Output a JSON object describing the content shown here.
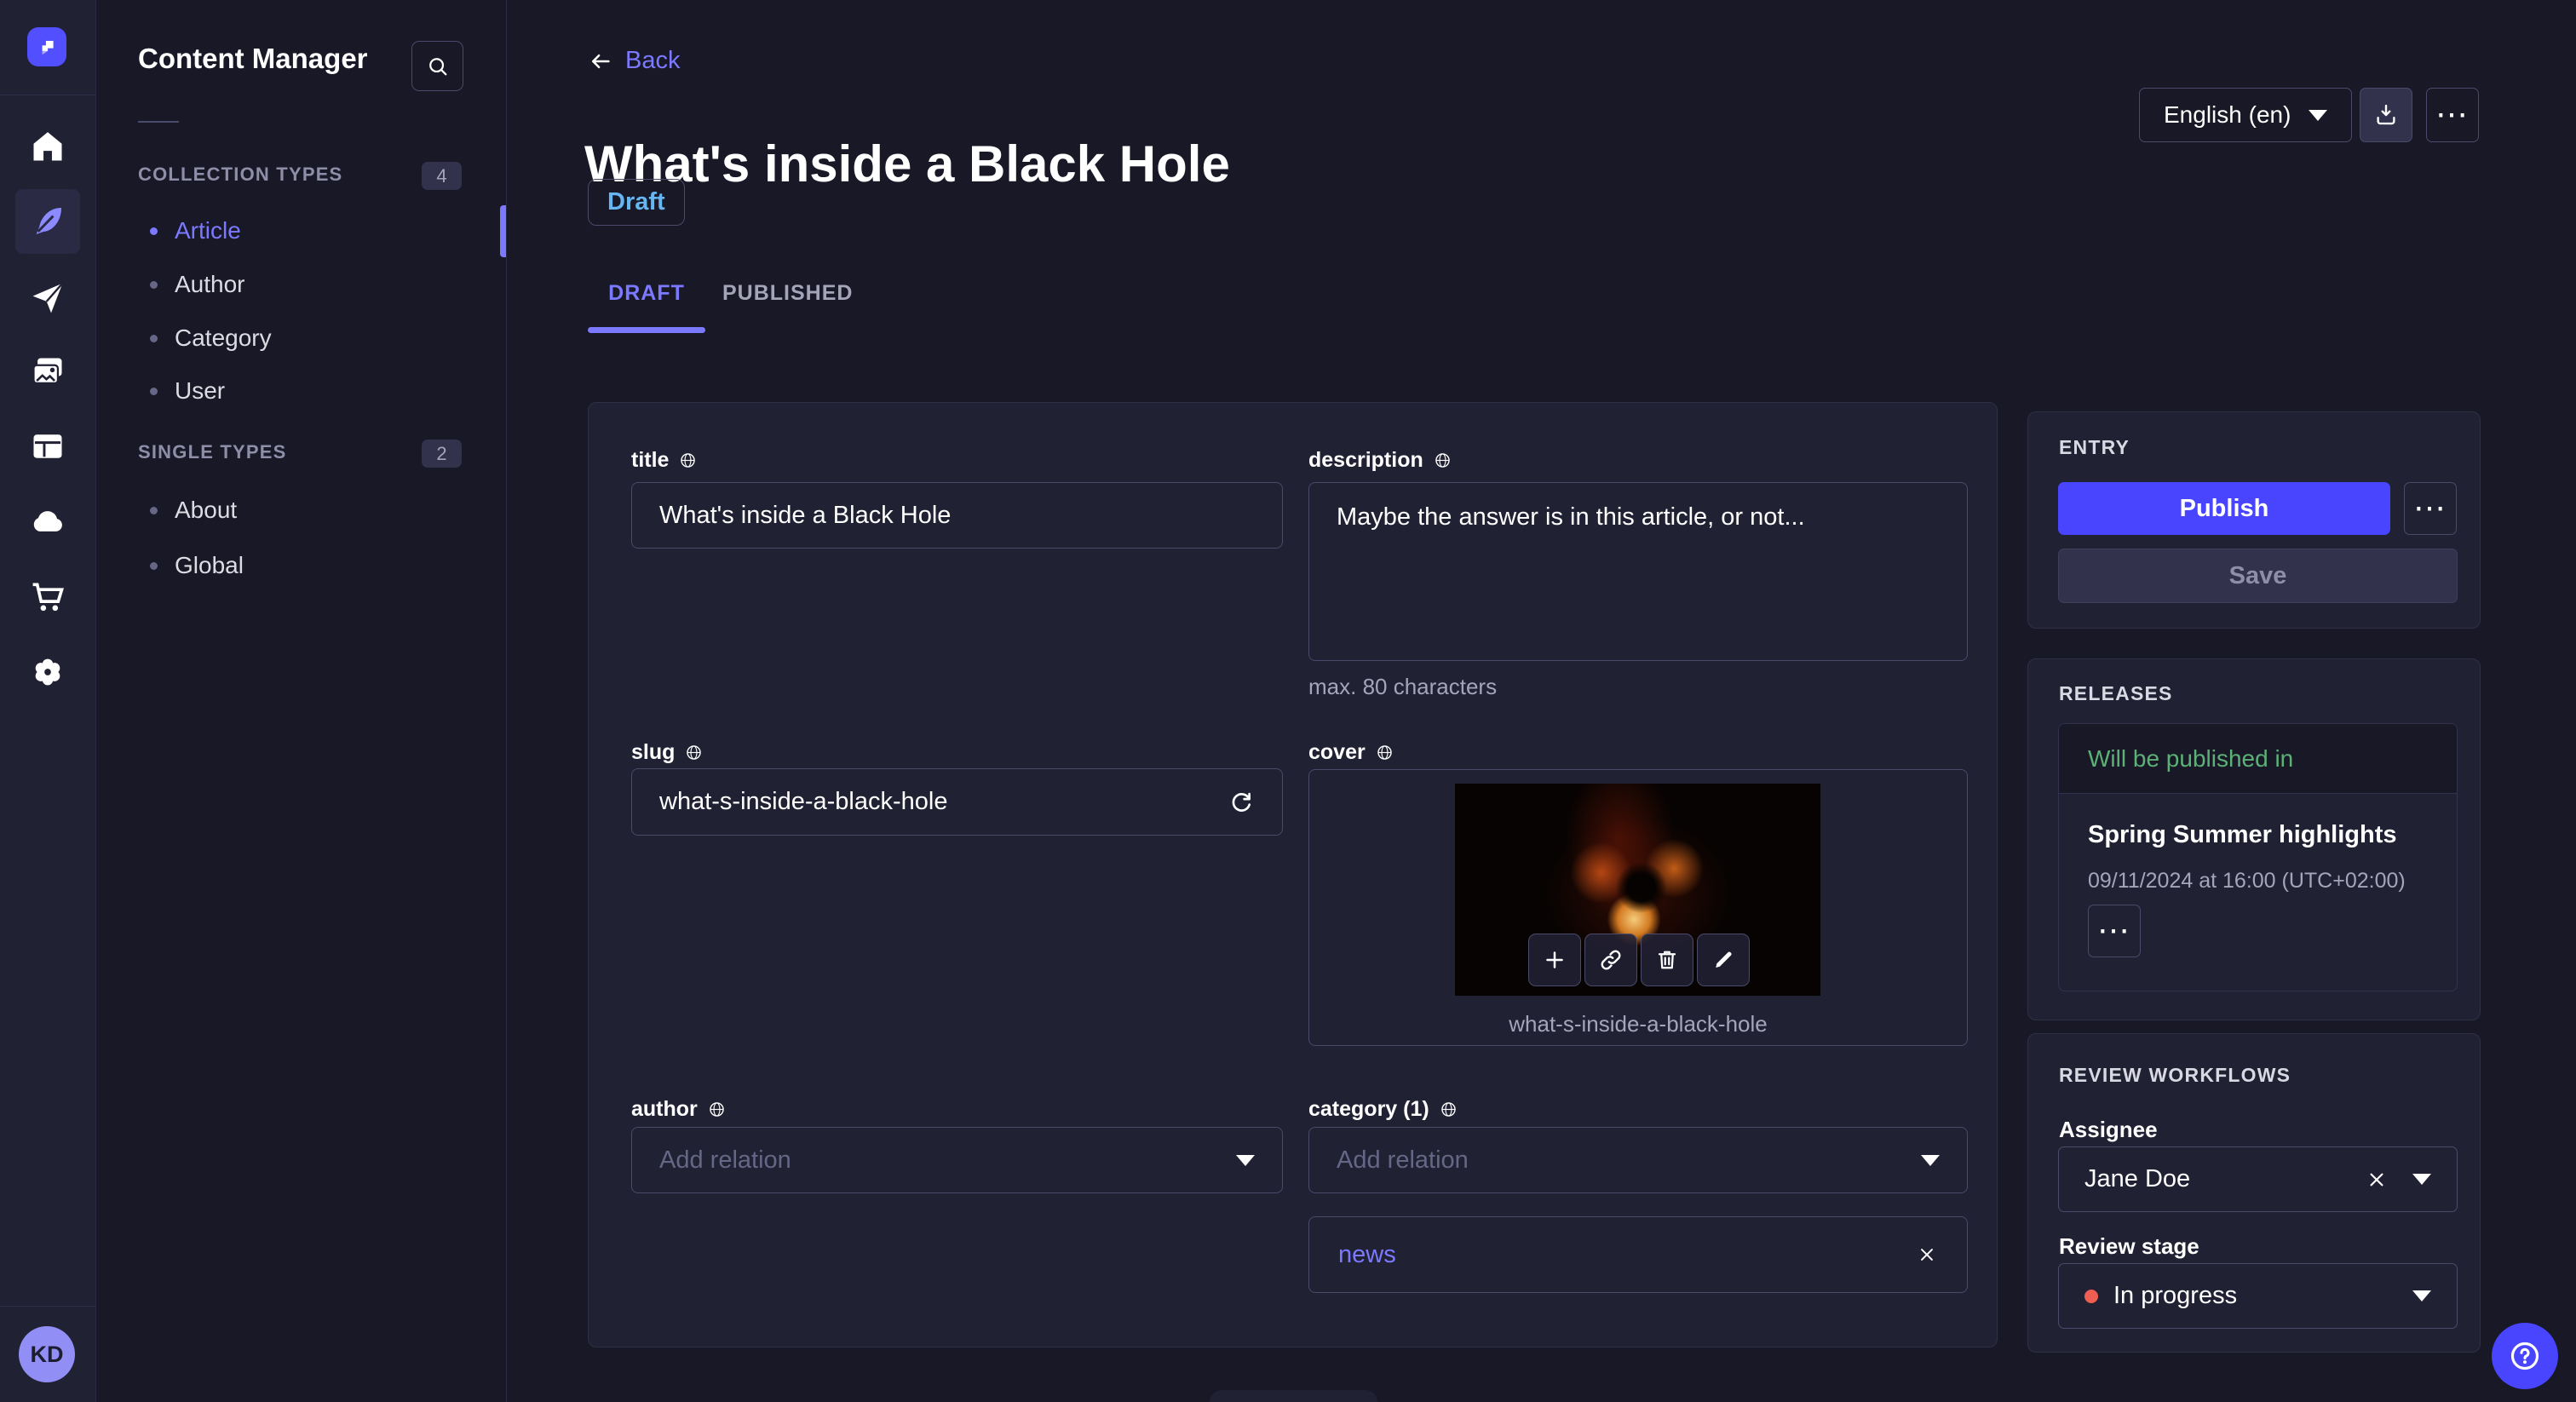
{
  "app": {
    "name": "Strapi admin"
  },
  "rail": {
    "icon_names": [
      "home-icon",
      "feather-icon",
      "send-icon",
      "media-icon",
      "layout-icon",
      "cloud-icon",
      "cart-icon",
      "gear-icon"
    ],
    "active_item": "content-manager",
    "avatar_initials": "KD"
  },
  "subnav": {
    "title": "Content Manager",
    "sections": [
      {
        "label": "COLLECTION TYPES",
        "count": "4",
        "items": [
          {
            "label": "Article"
          },
          {
            "label": "Author"
          },
          {
            "label": "Category"
          },
          {
            "label": "User"
          }
        ]
      },
      {
        "label": "SINGLE TYPES",
        "count": "2",
        "items": [
          {
            "label": "About"
          },
          {
            "label": "Global"
          }
        ]
      }
    ]
  },
  "header": {
    "back_label": "Back",
    "title": "What's inside a Black Hole",
    "status_badge": "Draft",
    "locale_select": "English (en)",
    "tabs": [
      {
        "label": "DRAFT"
      },
      {
        "label": "PUBLISHED"
      }
    ]
  },
  "form": {
    "title": {
      "label": "title",
      "value": "What's inside a Black Hole"
    },
    "description": {
      "label": "description",
      "value": "Maybe the answer is in this article, or not...",
      "hint": "max. 80 characters"
    },
    "slug": {
      "label": "slug",
      "value": "what-s-inside-a-black-hole"
    },
    "cover": {
      "label": "cover",
      "caption": "what-s-inside-a-black-hole"
    },
    "author": {
      "label": "author",
      "placeholder": "Add relation"
    },
    "category": {
      "label": "category (1)",
      "placeholder": "Add relation",
      "relations": [
        "news"
      ]
    }
  },
  "entry": {
    "heading": "ENTRY",
    "publish_label": "Publish",
    "save_label": "Save"
  },
  "releases": {
    "heading": "RELEASES",
    "status": "Will be published in",
    "title": "Spring Summer highlights",
    "datetime": "09/11/2024 at 16:00 (UTC+02:00)"
  },
  "review": {
    "heading": "REVIEW WORKFLOWS",
    "assignee_label": "Assignee",
    "assignee_value": "Jane Doe",
    "stage_label": "Review stage",
    "stage_value": "In progress"
  },
  "icons": {
    "more": "⋯"
  },
  "colors": {
    "primary": "#4945ff",
    "primary_light": "#7b79ff",
    "draft_status": "#66b7f1",
    "success": "#5cb176",
    "danger": "#ee5e52"
  }
}
